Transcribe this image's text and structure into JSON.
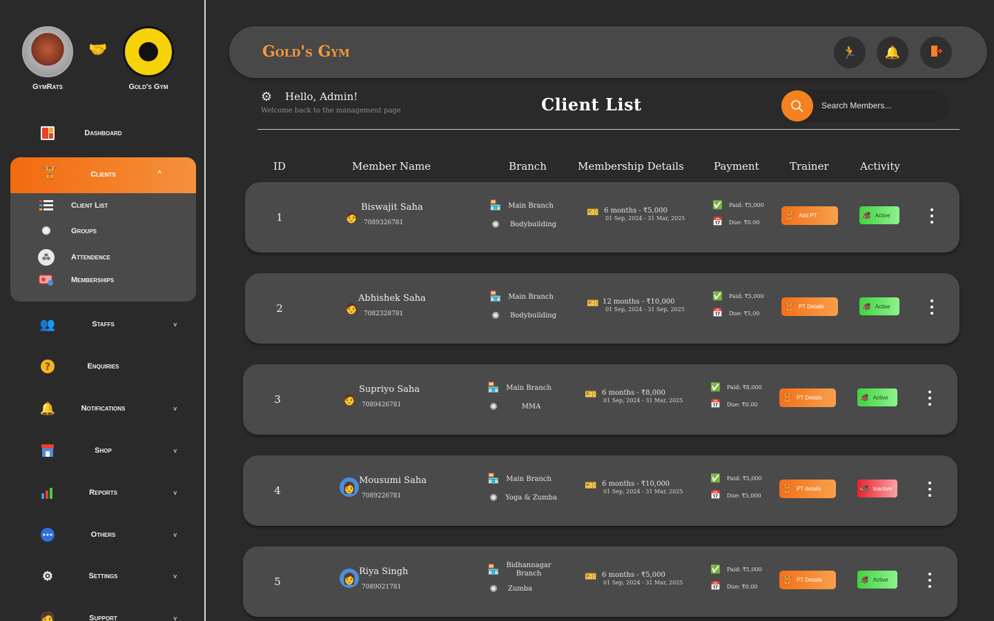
{
  "brands": {
    "left_label": "GymRats",
    "right_label": "Gold's Gym"
  },
  "sidebar": {
    "items": [
      {
        "label": "Dashboard",
        "icon": "dashboard-icon"
      },
      {
        "label": "Clients",
        "icon": "client-icon"
      },
      {
        "label": "Staffs",
        "icon": "staff-icon"
      },
      {
        "label": "Enquiries",
        "icon": "enquiry-icon"
      },
      {
        "label": "Notifications",
        "icon": "bell-icon"
      },
      {
        "label": "Shop",
        "icon": "shop-icon"
      },
      {
        "label": "Reports",
        "icon": "chart-icon"
      },
      {
        "label": "Others",
        "icon": "chat-icon"
      },
      {
        "label": "Settings",
        "icon": "settings-icon"
      },
      {
        "label": "Support",
        "icon": "support-icon"
      }
    ],
    "clients_sub": [
      {
        "label": "Client List",
        "icon": "list-icon"
      },
      {
        "label": "Groups",
        "icon": "groups-icon"
      },
      {
        "label": "Attendence",
        "icon": "attendance-icon"
      },
      {
        "label": "Memberships",
        "icon": "membership-card-icon"
      }
    ],
    "chevron_down": "v",
    "chevron_up": "^"
  },
  "header": {
    "title": "Gold's Gym"
  },
  "greeting": {
    "title": "Hello, Admin!",
    "subtitle": "Welcome back to the management page"
  },
  "page_title": "Client List",
  "search": {
    "placeholder": "Search Members..."
  },
  "table": {
    "columns": [
      "ID",
      "Member Name",
      "Branch",
      "Membership Details",
      "Payment",
      "Trainer",
      "Activity"
    ],
    "rows": [
      {
        "id": "1",
        "name": "Biswajit Saha",
        "phone": "7089326781",
        "branch": "Main Branch",
        "program": "Bodybuilding",
        "plan": "6 months - ₹5,000",
        "dates": "01 Sep, 2024 - 31 Mar, 2025",
        "paid": "Paid: ₹5,000",
        "due": "Due: ₹0.00",
        "trainer": "Add PT",
        "status": "Active"
      },
      {
        "id": "2",
        "name": "Abhishek Saha",
        "phone": "7082328781",
        "branch": "Main Branch",
        "program": "Bodybuilding",
        "plan": "12 months - ₹10,000",
        "dates": "01 Sep, 2024 - 31 Sep, 2025",
        "paid": "Paid: ₹5,000",
        "due": "Due: ₹5,00",
        "trainer": "PT Details",
        "status": "Active"
      },
      {
        "id": "3",
        "name": "Supriyo Saha",
        "phone": "7089426781",
        "branch": "Main Branch",
        "program": "MMA",
        "plan": "6 months - ₹8,000",
        "dates": "01 Sep, 2024 - 31 Mar, 2025",
        "paid": "Paid: ₹8,000",
        "due": "Due: ₹0.00",
        "trainer": "PT Details",
        "status": "Active"
      },
      {
        "id": "4",
        "name": "Mousumi Saha",
        "phone": "7089226781",
        "branch": "Main Branch",
        "program": "Yoga & Zumba",
        "plan": "6 months - ₹10,000",
        "dates": "01 Sep, 2024 - 31 Mar, 2025",
        "paid": "Paid: ₹5,000",
        "due": "Due: ₹5,000",
        "trainer": "PT details",
        "status": "Inactive"
      },
      {
        "id": "5",
        "name": "Riya Singh",
        "phone": "7089021781",
        "branch": "Bidhannagar Branch",
        "program": "Zumba",
        "plan": "6 months - ₹5,000",
        "dates": "01 Sep, 2024 - 31 Mar, 2025",
        "paid": "Paid: ₹5,000",
        "due": "Due: ₹0.00",
        "trainer": "PT Details",
        "status": "Active"
      }
    ]
  },
  "colors": {
    "accent": "#f5821f",
    "background": "#2a2a2a",
    "card": "#4a4a4a",
    "active": "#3fd43f",
    "inactive": "#e8202c"
  }
}
